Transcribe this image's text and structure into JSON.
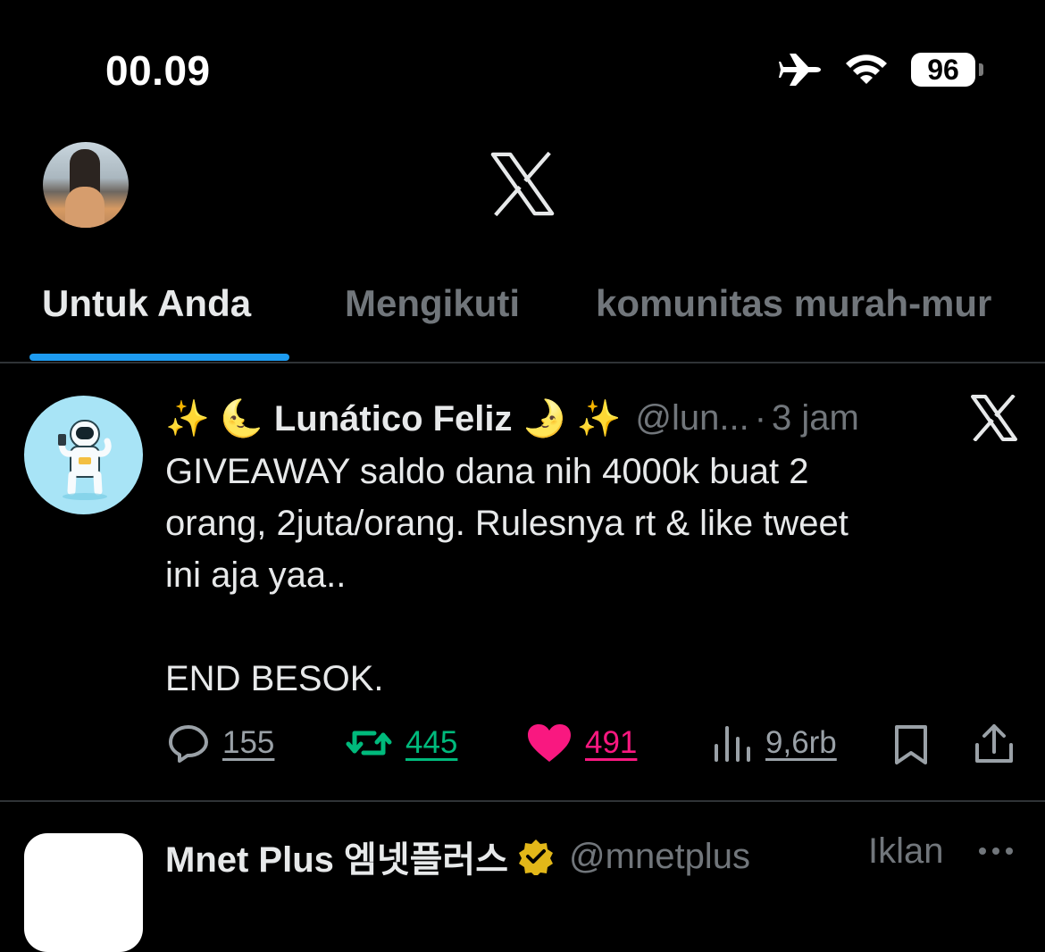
{
  "status_bar": {
    "time": "00.09",
    "battery": "96",
    "icons": [
      "airplane-icon",
      "wifi-icon",
      "battery-icon"
    ]
  },
  "header": {
    "logo_icon": "x-logo-icon",
    "avatar_icon": "profile-avatar"
  },
  "tabs": [
    {
      "label": "Untuk Anda",
      "active": true
    },
    {
      "label": "Mengikuti",
      "active": false
    },
    {
      "label": "komunitas murah-mur",
      "active": false
    }
  ],
  "tweet": {
    "display_name": "✨ 🌜 Lunático Feliz 🌛 ✨",
    "handle": "@lun...",
    "separator": "·",
    "time": "3 jam",
    "source_icon": "x-logo-icon",
    "body": "GIVEAWAY saldo dana nih 4000k buat 2\norang, 2juta/orang. Rulesnya rt & like tweet\nini aja yaa..\n\nEND BESOK.",
    "actions": {
      "replies": "155",
      "reposts": "445",
      "likes": "491",
      "views": "9,6rb"
    },
    "colors": {
      "repost": "#00ba7c",
      "like": "#f91880",
      "tab_indicator": "#1d9bf0"
    }
  },
  "next_tweet": {
    "display_name": "Mnet Plus 엠넷플러스",
    "handle": "@mnetplus",
    "ad_label": "Iklan",
    "badge_icon": "verified-gold-badge-icon"
  }
}
